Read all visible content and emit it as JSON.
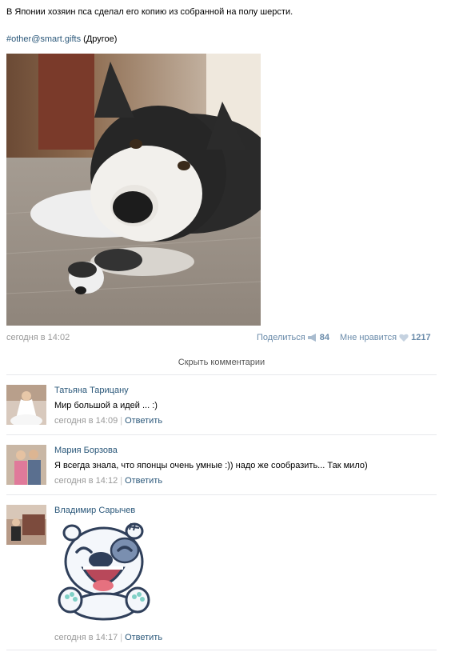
{
  "post": {
    "text": "В Японии хозяин пса сделал его копию из собранной на полу шерсти.",
    "hashtag": "#other@smart.gifts",
    "category": "(Другое)",
    "date": "сегодня в 14:02",
    "share_label": "Поделиться",
    "share_count": "84",
    "like_label": "Мне нравится",
    "like_count": "1217"
  },
  "comments_toggle": "Скрыть комментарии",
  "comments": [
    {
      "author": "Татьяна Тарицану",
      "text": "Мир большой а идей ... :)",
      "date": "сегодня в 14:09",
      "reply": "Ответить"
    },
    {
      "author": "Мария Борзова",
      "text": "Я всегда знала, что японцы очень умные :)) надо же сообразить... Так мило)",
      "date": "сегодня в 14:12",
      "reply": "Ответить"
    },
    {
      "author": "Владимир Сарычев",
      "text": "",
      "date": "сегодня в 14:17",
      "reply": "Ответить"
    }
  ],
  "colors": {
    "link": "#2b587a",
    "meta": "#999999",
    "action": "#6a8baa",
    "divider": "#e7e8ec"
  },
  "icons": {
    "share": "megaphone-icon",
    "like": "heart-icon"
  }
}
